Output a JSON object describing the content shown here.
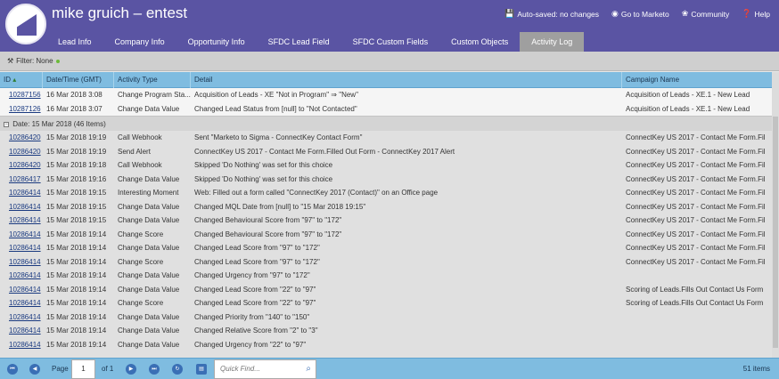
{
  "app": {
    "title": "mike gruich – entest",
    "top_links": [
      {
        "icon": "save-icon",
        "glyph": "💾",
        "label": "Auto-saved: no changes"
      },
      {
        "icon": "marketo-icon",
        "glyph": "◉",
        "label": "Go to Marketo"
      },
      {
        "icon": "community-icon",
        "glyph": "❀",
        "label": "Community"
      },
      {
        "icon": "help-icon",
        "glyph": "❓",
        "label": "Help"
      }
    ],
    "tabs": [
      "Lead Info",
      "Company Info",
      "Opportunity Info",
      "SFDC Lead Field",
      "SFDC Custom Fields",
      "Custom Objects",
      "Activity Log"
    ],
    "active_tab": "Activity Log"
  },
  "filter": {
    "label": "Filter: None"
  },
  "columns": [
    "ID",
    "Date/Time (GMT)",
    "Activity Type",
    "Detail",
    "Campaign Name"
  ],
  "rows_top": [
    {
      "id": "10287156",
      "dt": "16 Mar 2018 3:08",
      "type": "Change Program Sta...",
      "detail": "Acquisition of Leads - XE \"Not in Program\" ⇒ \"New\"",
      "camp": "Acquisition of Leads - XE.1 - New Lead"
    },
    {
      "id": "10287126",
      "dt": "16 Mar 2018 3:07",
      "type": "Change Data Value",
      "detail": "Changed Lead Status from [null] to \"Not Contacted\"",
      "camp": "Acquisition of Leads - XE.1 - New Lead"
    }
  ],
  "group": {
    "label": "Date: 15 Mar 2018 (46 Items)"
  },
  "rows": [
    {
      "id": "10286420",
      "dt": "15 Mar 2018 19:19",
      "type": "Call Webhook",
      "detail": "Sent \"Marketo to Sigma - ConnectKey Contact Form\"",
      "camp": "ConnectKey US 2017 - Contact Me Form.Fill..."
    },
    {
      "id": "10286420",
      "dt": "15 Mar 2018 19:19",
      "type": "Send Alert",
      "detail": "ConnectKey US 2017 - Contact Me Form.Filled Out Form - ConnectKey 2017 Alert",
      "camp": "ConnectKey US 2017 - Contact Me Form.Fill..."
    },
    {
      "id": "10286420",
      "dt": "15 Mar 2018 19:18",
      "type": "Call Webhook",
      "detail": "Skipped 'Do Nothing' was set for this choice",
      "camp": "ConnectKey US 2017 - Contact Me Form.Fill..."
    },
    {
      "id": "10286417",
      "dt": "15 Mar 2018 19:16",
      "type": "Change Data Value",
      "detail": "Skipped 'Do Nothing' was set for this choice",
      "camp": "ConnectKey US 2017 - Contact Me Form.Fill..."
    },
    {
      "id": "10286414",
      "dt": "15 Mar 2018 19:15",
      "type": "Interesting Moment",
      "detail": "Web: Filled out a form called \"ConnectKey 2017 (Contact)\" on an Office page",
      "camp": "ConnectKey US 2017 - Contact Me Form.Fill..."
    },
    {
      "id": "10286414",
      "dt": "15 Mar 2018 19:15",
      "type": "Change Data Value",
      "detail": "Changed MQL Date from [null] to \"15 Mar 2018 19:15\"",
      "camp": "ConnectKey US 2017 - Contact Me Form.Fill..."
    },
    {
      "id": "10286414",
      "dt": "15 Mar 2018 19:15",
      "type": "Change Data Value",
      "detail": "Changed Behavioural Score from \"97\" to \"172\"",
      "camp": "ConnectKey US 2017 - Contact Me Form.Fill..."
    },
    {
      "id": "10286414",
      "dt": "15 Mar 2018 19:14",
      "type": "Change Score",
      "detail": "Changed Behavioural Score from \"97\" to \"172\"",
      "camp": "ConnectKey US 2017 - Contact Me Form.Fill..."
    },
    {
      "id": "10286414",
      "dt": "15 Mar 2018 19:14",
      "type": "Change Data Value",
      "detail": "Changed Lead Score from \"97\" to \"172\"",
      "camp": "ConnectKey US 2017 - Contact Me Form.Fill..."
    },
    {
      "id": "10286414",
      "dt": "15 Mar 2018 19:14",
      "type": "Change Score",
      "detail": "Changed Lead Score from \"97\" to \"172\"",
      "camp": "ConnectKey US 2017 - Contact Me Form.Fill..."
    },
    {
      "id": "10286414",
      "dt": "15 Mar 2018 19:14",
      "type": "Change Data Value",
      "detail": "Changed Urgency from \"97\" to \"172\"",
      "camp": ""
    },
    {
      "id": "10286414",
      "dt": "15 Mar 2018 19:14",
      "type": "Change Data Value",
      "detail": "Changed Lead Score from \"22\" to \"97\"",
      "camp": "Scoring of Leads.Fills Out Contact Us Form"
    },
    {
      "id": "10286414",
      "dt": "15 Mar 2018 19:14",
      "type": "Change Score",
      "detail": "Changed Lead Score from \"22\" to \"97\"",
      "camp": "Scoring of Leads.Fills Out Contact Us Form"
    },
    {
      "id": "10286414",
      "dt": "15 Mar 2018 19:14",
      "type": "Change Data Value",
      "detail": "Changed Priority from \"140\" to \"150\"",
      "camp": ""
    },
    {
      "id": "10286414",
      "dt": "15 Mar 2018 19:14",
      "type": "Change Data Value",
      "detail": "Changed Relative Score from \"2\" to \"3\"",
      "camp": ""
    },
    {
      "id": "10286414",
      "dt": "15 Mar 2018 19:14",
      "type": "Change Data Value",
      "detail": "Changed Urgency from \"22\" to \"97\"",
      "camp": ""
    }
  ],
  "pager": {
    "page_label": "Page",
    "page_value": "1",
    "of_label": "of 1",
    "quickfind_placeholder": "Quick Find...",
    "count": "51 items"
  }
}
